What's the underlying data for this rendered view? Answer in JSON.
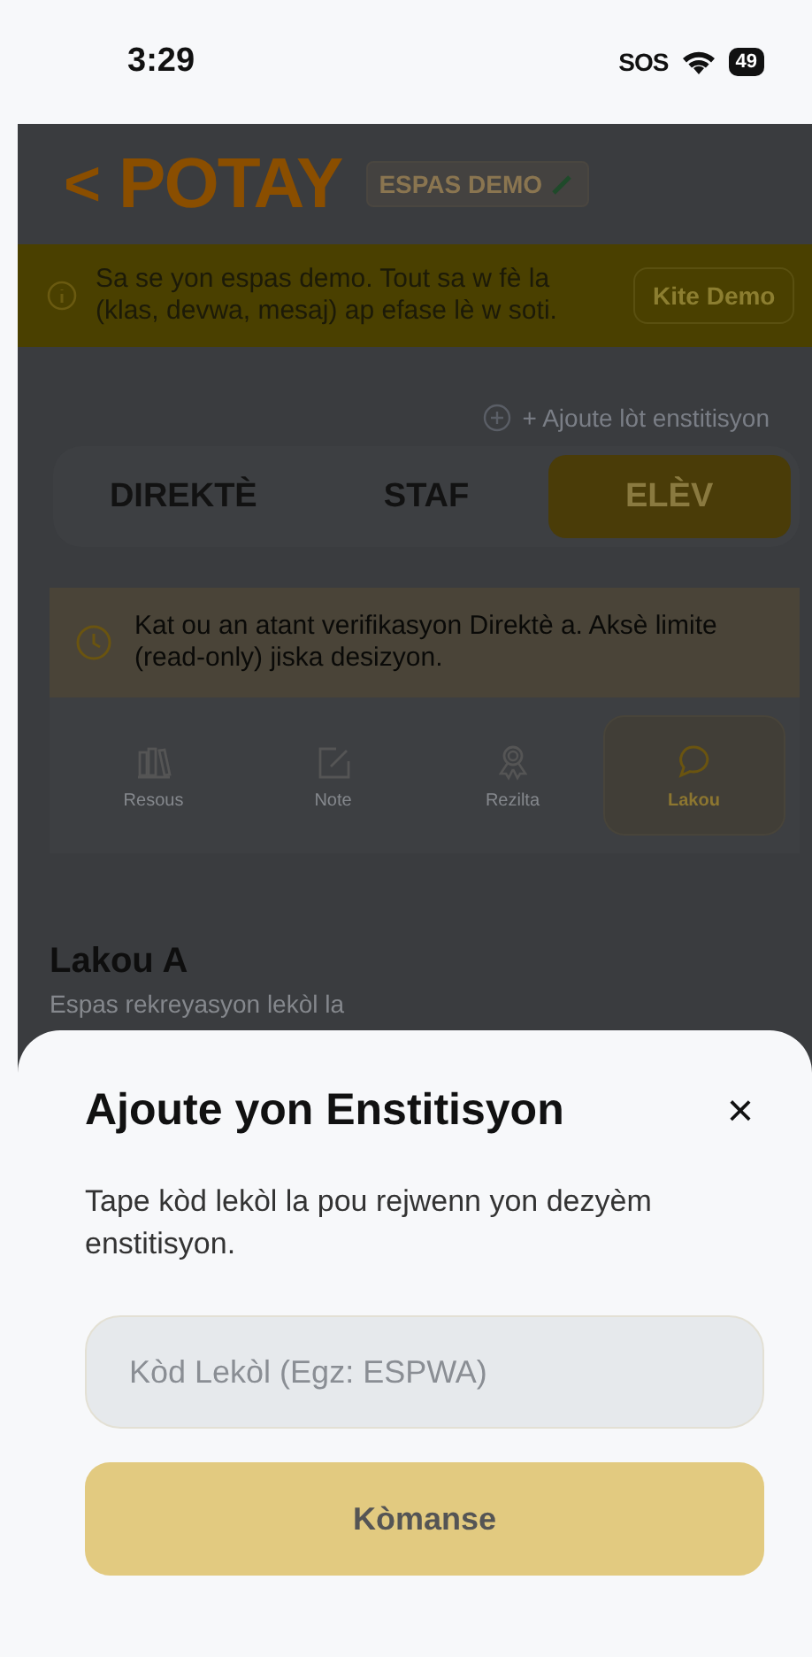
{
  "status_bar": {
    "time": "3:29",
    "sos": "SOS",
    "battery": "49"
  },
  "header": {
    "back": "<",
    "title": "POTAY",
    "badge": "ESPAS DEMO"
  },
  "demo_banner": {
    "text": "Sa se yon espas demo. Tout sa w fè la (klas, devwa, mesaj) ap efase lè w soti.",
    "button": "Kite Demo"
  },
  "add_link": "+ Ajoute lòt enstitisyon",
  "role_tabs": [
    {
      "label": "DIREKTÈ",
      "selected": false
    },
    {
      "label": "STAF",
      "selected": false
    },
    {
      "label": "ELÈV",
      "selected": true
    }
  ],
  "pending_notice": "Kat ou an atant verifikasyon Direktè a. Aksè limite (read-only) jiska desizyon.",
  "sections": [
    {
      "kind": "books",
      "label": "Resous",
      "selected": false
    },
    {
      "kind": "edit",
      "label": "Note",
      "selected": false
    },
    {
      "kind": "award",
      "label": "Rezilta",
      "selected": false
    },
    {
      "kind": "chat",
      "label": "Lakou",
      "selected": true
    }
  ],
  "content": {
    "title": "Lakou A",
    "subtitle": "Espas rekreyasyon lekòl la"
  },
  "sheet": {
    "title": "Ajoute yon Enstitisyon",
    "close": "×",
    "description": "Tape kòd lekòl la pou rejwenn yon dezyèm enstitisyon.",
    "field": {
      "placeholder": "Kòd Lekòl (Egz: ESPWA)"
    },
    "button": "Kòmanse"
  }
}
